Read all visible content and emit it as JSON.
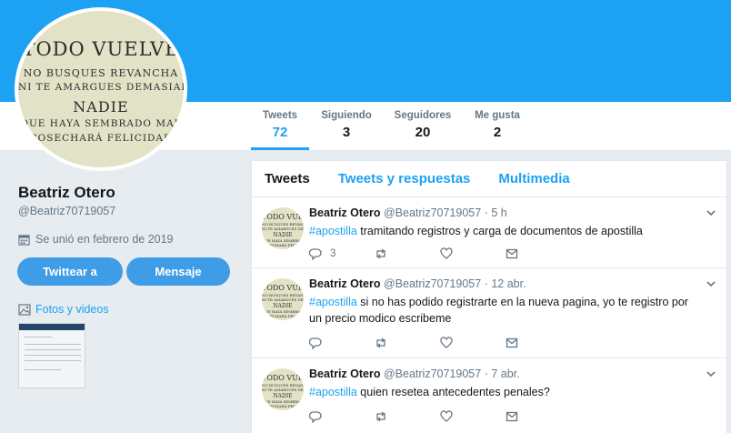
{
  "profile": {
    "name": "Beatriz Otero",
    "handle": "@Beatriz70719057",
    "joined": "Se unió en febrero de 2019",
    "avatar_text": [
      "TODO VUELVE",
      "NO BUSQUES REVANCHA",
      "NI TE AMARGUES DEMASIADO.",
      "NADIE",
      "QUE HAYA SEMBRADO MAL",
      "COSECHARÁ FELICIDAD"
    ],
    "tweet_button": "Twittear a",
    "message_button": "Mensaje",
    "media_link": "Fotos y videos"
  },
  "stats": [
    {
      "label": "Tweets",
      "value": "72"
    },
    {
      "label": "Siguiendo",
      "value": "3"
    },
    {
      "label": "Seguidores",
      "value": "20"
    },
    {
      "label": "Me gusta",
      "value": "2"
    }
  ],
  "tabs": [
    "Tweets",
    "Tweets y respuestas",
    "Multimedia"
  ],
  "tweets": [
    {
      "author": "Beatriz Otero",
      "handle": "@Beatriz70719057",
      "time": "· 5 h",
      "hashtag": "#apostilla",
      "text": " tramitando registros y carga de documentos de apostilla",
      "reply_count": "3"
    },
    {
      "author": "Beatriz Otero",
      "handle": "@Beatriz70719057",
      "time": "· 12 abr.",
      "hashtag": "#apostilla",
      "text": " si no has podido registrarte en la nueva pagina, yo te registro por un precio modico escribeme",
      "reply_count": ""
    },
    {
      "author": "Beatriz Otero",
      "handle": "@Beatriz70719057",
      "time": "· 7 abr.",
      "hashtag": "#apostilla",
      "text": " quien resetea antecedentes penales?",
      "reply_count": ""
    }
  ],
  "colors": {
    "brand": "#1da1f2",
    "button": "#3f9ce6",
    "muted": "#657786",
    "background": "#e6ecf0"
  },
  "icons": [
    "calendar-icon",
    "photo-icon",
    "reply-icon",
    "retweet-icon",
    "like-icon",
    "dm-icon",
    "chevron-down-icon"
  ]
}
